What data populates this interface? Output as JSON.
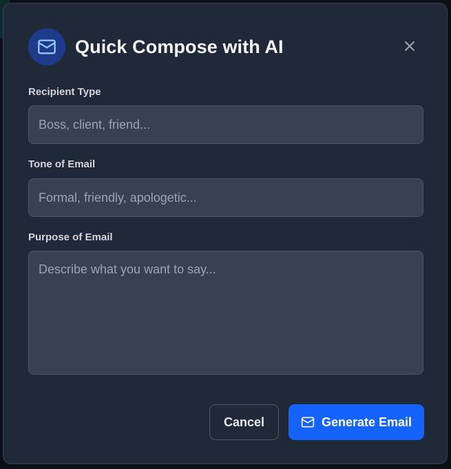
{
  "dialog": {
    "title": "Quick Compose with AI",
    "header_icon": "mail-icon",
    "close_icon": "close-icon"
  },
  "fields": {
    "recipient": {
      "label": "Recipient Type",
      "value": "",
      "placeholder": "Boss, client, friend..."
    },
    "tone": {
      "label": "Tone of Email",
      "value": "",
      "placeholder": "Formal, friendly, apologetic..."
    },
    "purpose": {
      "label": "Purpose of Email",
      "value": "",
      "placeholder": "Describe what you want to say..."
    }
  },
  "actions": {
    "cancel_label": "Cancel",
    "generate_label": "Generate Email",
    "generate_icon": "mail-icon"
  },
  "colors": {
    "dialog_bg": "#1f2937",
    "input_bg": "#374151",
    "accent": "#1463ff",
    "header_icon_bg": "#1e3a8a"
  }
}
